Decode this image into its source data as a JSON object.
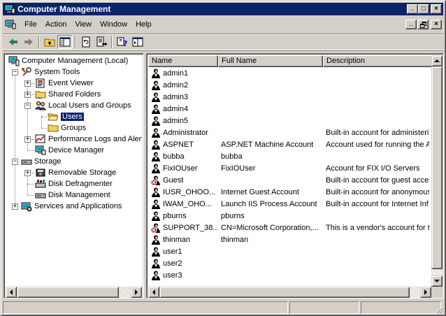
{
  "window": {
    "title": "Computer Management",
    "min_glyph": "_",
    "max_glyph": "□",
    "close_glyph": "×"
  },
  "menu": {
    "items": [
      "File",
      "Action",
      "View",
      "Window",
      "Help"
    ]
  },
  "toolbar": {
    "buttons": [
      "back-icon",
      "forward-icon",
      "up-folder-icon",
      "show-hide-tree-icon",
      "refresh-icon",
      "export-list-icon",
      "help-icon",
      "action-pane-icon"
    ]
  },
  "tree": {
    "root": "Computer Management (Local)",
    "system_tools": "System Tools",
    "event_viewer": "Event Viewer",
    "shared_folders": "Shared Folders",
    "local_users_groups": "Local Users and Groups",
    "users": "Users",
    "groups": "Groups",
    "perf_logs": "Performance Logs and Alerts",
    "device_manager": "Device Manager",
    "storage": "Storage",
    "removable_storage": "Removable Storage",
    "disk_defrag": "Disk Defragmenter",
    "disk_management": "Disk Management",
    "services_apps": "Services and Applications"
  },
  "list": {
    "columns": [
      "Name",
      "Full Name",
      "Description"
    ],
    "rows": [
      {
        "name": "admin1",
        "full": "",
        "desc": "",
        "disabled": false
      },
      {
        "name": "admin2",
        "full": "",
        "desc": "",
        "disabled": false
      },
      {
        "name": "admin3",
        "full": "",
        "desc": "",
        "disabled": false
      },
      {
        "name": "admin4",
        "full": "",
        "desc": "",
        "disabled": false
      },
      {
        "name": "admin5",
        "full": "",
        "desc": "",
        "disabled": false
      },
      {
        "name": "Administrator",
        "full": "",
        "desc": "Built-in account for administering",
        "disabled": false
      },
      {
        "name": "ASPNET",
        "full": "ASP.NET Machine Account",
        "desc": "Account used for running the A",
        "disabled": false
      },
      {
        "name": "bubba",
        "full": "bubba",
        "desc": "",
        "disabled": false
      },
      {
        "name": "FixIOUser",
        "full": "FixIOUser",
        "desc": "Account for FIX I/O Servers",
        "disabled": false
      },
      {
        "name": "Guest",
        "full": "",
        "desc": "Built-in account for guest acces",
        "disabled": true
      },
      {
        "name": "IUSR_OHOO...",
        "full": "Internet Guest Account",
        "desc": "Built-in account for anonymous",
        "disabled": false
      },
      {
        "name": "IWAM_OHO...",
        "full": "Launch IIS Process Account",
        "desc": "Built-in account for Internet Inf",
        "disabled": false
      },
      {
        "name": "pburns",
        "full": "pburns",
        "desc": "",
        "disabled": false
      },
      {
        "name": "SUPPORT_38...",
        "full": "CN=Microsoft Corporation,...",
        "desc": "This is a vendor's account for th",
        "disabled": true
      },
      {
        "name": "thinman",
        "full": "thinman",
        "desc": "",
        "disabled": false
      },
      {
        "name": "user1",
        "full": "",
        "desc": "",
        "disabled": false
      },
      {
        "name": "user2",
        "full": "",
        "desc": "",
        "disabled": false
      },
      {
        "name": "user3",
        "full": "",
        "desc": "",
        "disabled": false
      }
    ]
  },
  "colors": {
    "title_bar": "#0a246a",
    "selection": "#0a246a",
    "face": "#d4d0c8",
    "disabled_badge": "#c00000"
  }
}
